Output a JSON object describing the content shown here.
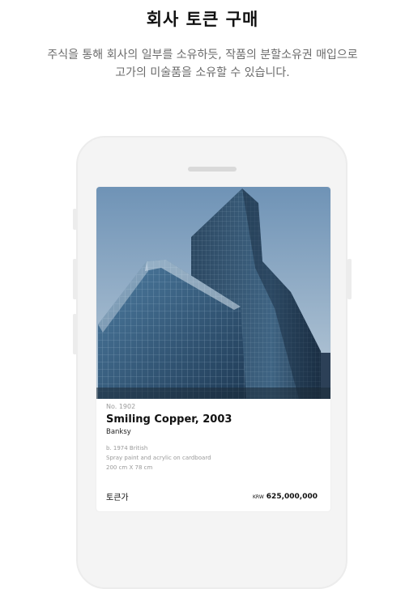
{
  "header": {
    "title": "회사 토큰 구매",
    "subtitle_line1": "주식을 통해 회사의 일부를 소유하듯, 작품의 분할소유권 매입으로",
    "subtitle_line2": "고가의 미술품을 소유할 수 있습니다."
  },
  "card": {
    "lot_number": "No. 1902",
    "artwork_title": "Smiling Copper, 2003",
    "artist": "Banksy",
    "artist_bio": "b. 1974 British",
    "medium": "Spray paint and acrylic on cardboard",
    "dimensions": "200 cm X 78 cm",
    "price_label": "토큰가",
    "currency": "KRW",
    "price": "625,000,000"
  },
  "colors": {
    "sky": "#8aaac6",
    "glass": "#2c4660",
    "phone_frame": "#f4f4f4"
  }
}
